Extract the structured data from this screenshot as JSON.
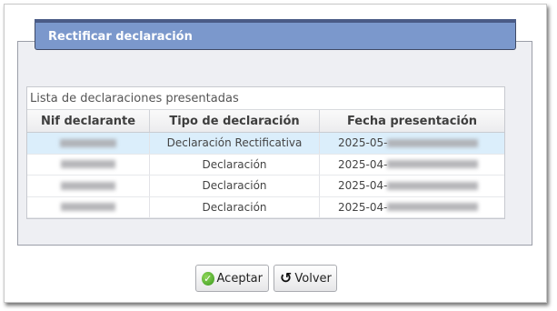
{
  "panel": {
    "title": "Rectificar declaración"
  },
  "list": {
    "caption": "Lista de declaraciones presentadas",
    "columns": [
      "Nif declarante",
      "Tipo de declaración",
      "Fecha presentación"
    ],
    "rows": [
      {
        "tipo": "Declaración Rectificativa",
        "fecha": "2025-05-",
        "selected": true
      },
      {
        "tipo": "Declaración",
        "fecha": "2025-04-",
        "selected": false
      },
      {
        "tipo": "Declaración",
        "fecha": "2025-04-",
        "selected": false
      },
      {
        "tipo": "Declaración",
        "fecha": "2025-04-",
        "selected": false
      }
    ]
  },
  "buttons": {
    "accept": "Aceptar",
    "back": "Volver"
  },
  "icons": {
    "accept": "check-circle-icon",
    "back": "undo-icon"
  },
  "colors": {
    "header": "#7b98cc",
    "selected_row": "#dbeefb",
    "accept_icon": "#3a9a1d"
  }
}
